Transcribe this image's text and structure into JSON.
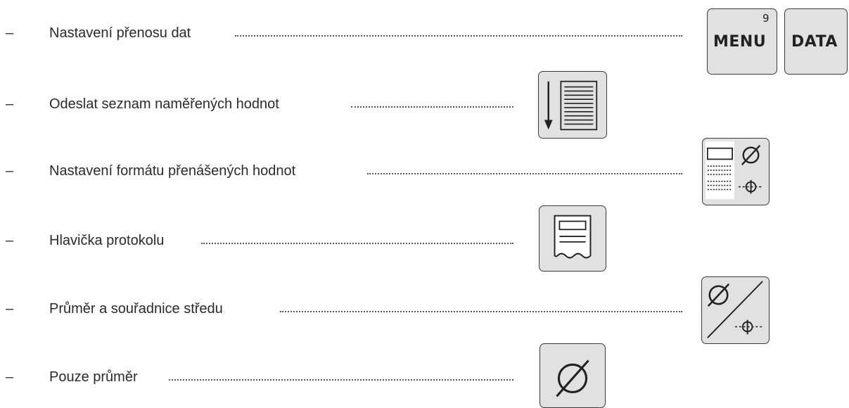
{
  "items": [
    {
      "dash": "–",
      "label": "Nastavení přenosu dat"
    },
    {
      "dash": "–",
      "label": "Odeslat seznam naměřených hodnot"
    },
    {
      "dash": "–",
      "label": "Nastavení formátu přenášených hodnot"
    },
    {
      "dash": "–",
      "label": "Hlavička protokolu"
    },
    {
      "dash": "–",
      "label": "Průměr a souřadnice středu"
    },
    {
      "dash": "–",
      "label": "Pouze průměr"
    }
  ],
  "keys": {
    "menu": {
      "label": "MENU",
      "number": "9"
    },
    "data": {
      "label": "DATA"
    },
    "send_list": {
      "icon": "send-list-icon"
    },
    "format": {
      "icon": "format-diameter-center-icon"
    },
    "header": {
      "icon": "protocol-header-icon"
    },
    "diameter_center": {
      "icon": "diameter-and-center-icon"
    },
    "diameter_only": {
      "icon": "diameter-icon"
    }
  }
}
